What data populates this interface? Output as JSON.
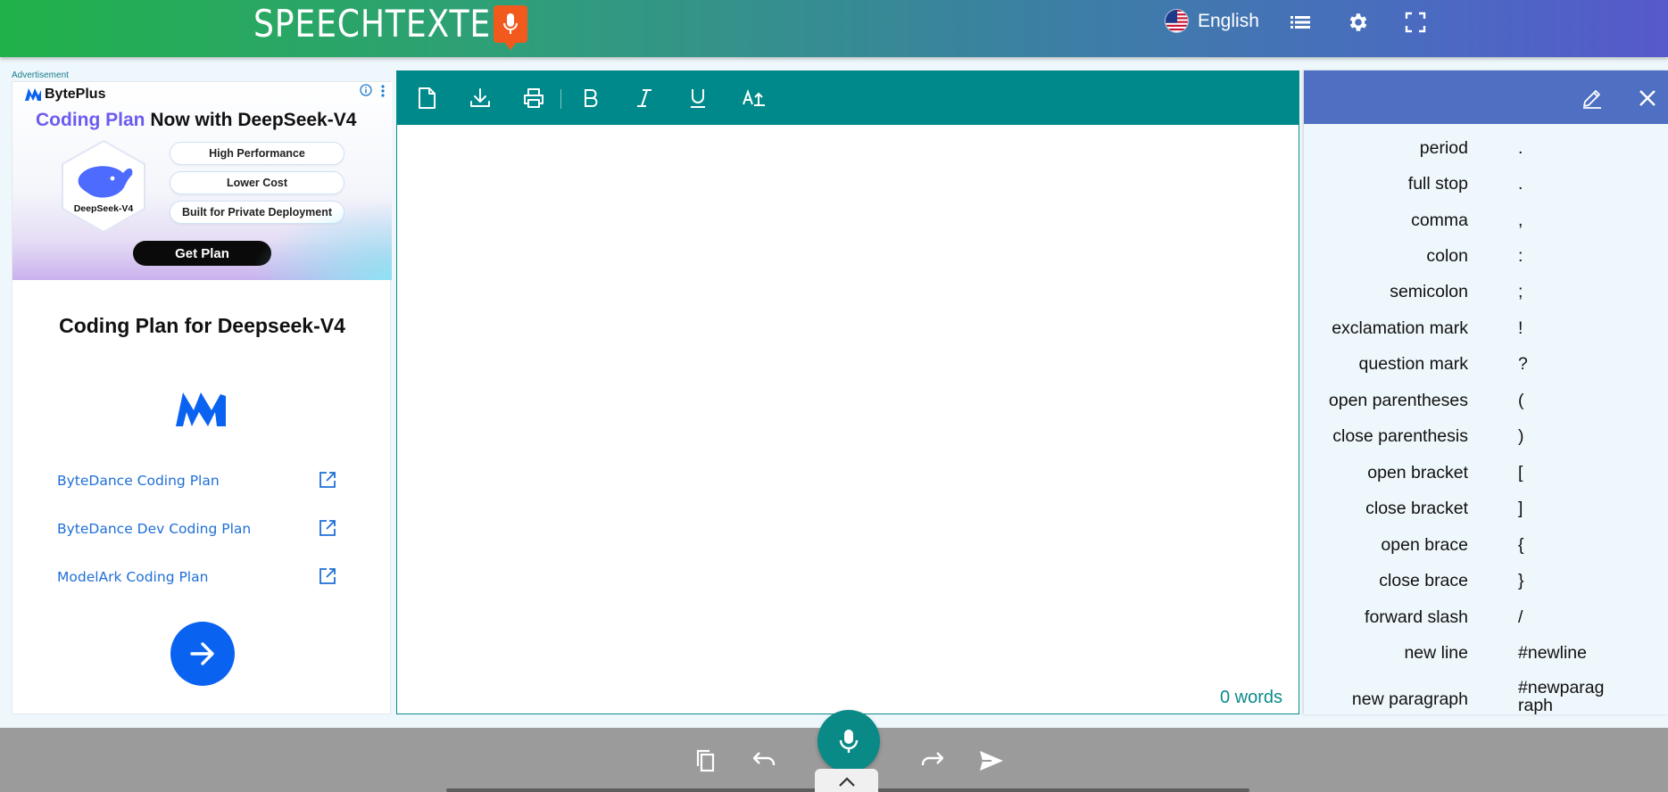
{
  "header": {
    "logo_text": "SPEECHTEXTER",
    "language": "English"
  },
  "ad": {
    "label": "Advertisement",
    "brand": "BytePlus",
    "headline_accent": "Coding Plan",
    "headline_rest": "Now with DeepSeek-V4",
    "model_name": "DeepSeek-V4",
    "features": [
      "High Performance",
      "Lower Cost",
      "Built for Private Deployment"
    ],
    "cta": "Get Plan",
    "title": "Coding Plan for Deepseek-V4",
    "links": [
      "ByteDance Coding Plan",
      "ByteDance Dev Coding Plan",
      "ModelArk Coding Plan"
    ]
  },
  "editor": {
    "word_count": "0 words"
  },
  "commands": [
    {
      "name": "period",
      "value": "."
    },
    {
      "name": "full stop",
      "value": "."
    },
    {
      "name": "comma",
      "value": ","
    },
    {
      "name": "colon",
      "value": ":"
    },
    {
      "name": "semicolon",
      "value": ";"
    },
    {
      "name": "exclamation mark",
      "value": "!"
    },
    {
      "name": "question mark",
      "value": "?"
    },
    {
      "name": "open parentheses",
      "value": "("
    },
    {
      "name": "close parenthesis",
      "value": ")"
    },
    {
      "name": "open bracket",
      "value": "["
    },
    {
      "name": "close bracket",
      "value": "]"
    },
    {
      "name": "open brace",
      "value": "{"
    },
    {
      "name": "close brace",
      "value": "}"
    },
    {
      "name": "forward slash",
      "value": "/"
    },
    {
      "name": "new line",
      "value": "#newline"
    },
    {
      "name": "new paragraph",
      "value": "#newparag\nraph"
    }
  ],
  "colors": {
    "teal": "#00898a",
    "panel_header": "#4e6fc2",
    "link_blue": "#1f6fd6"
  }
}
